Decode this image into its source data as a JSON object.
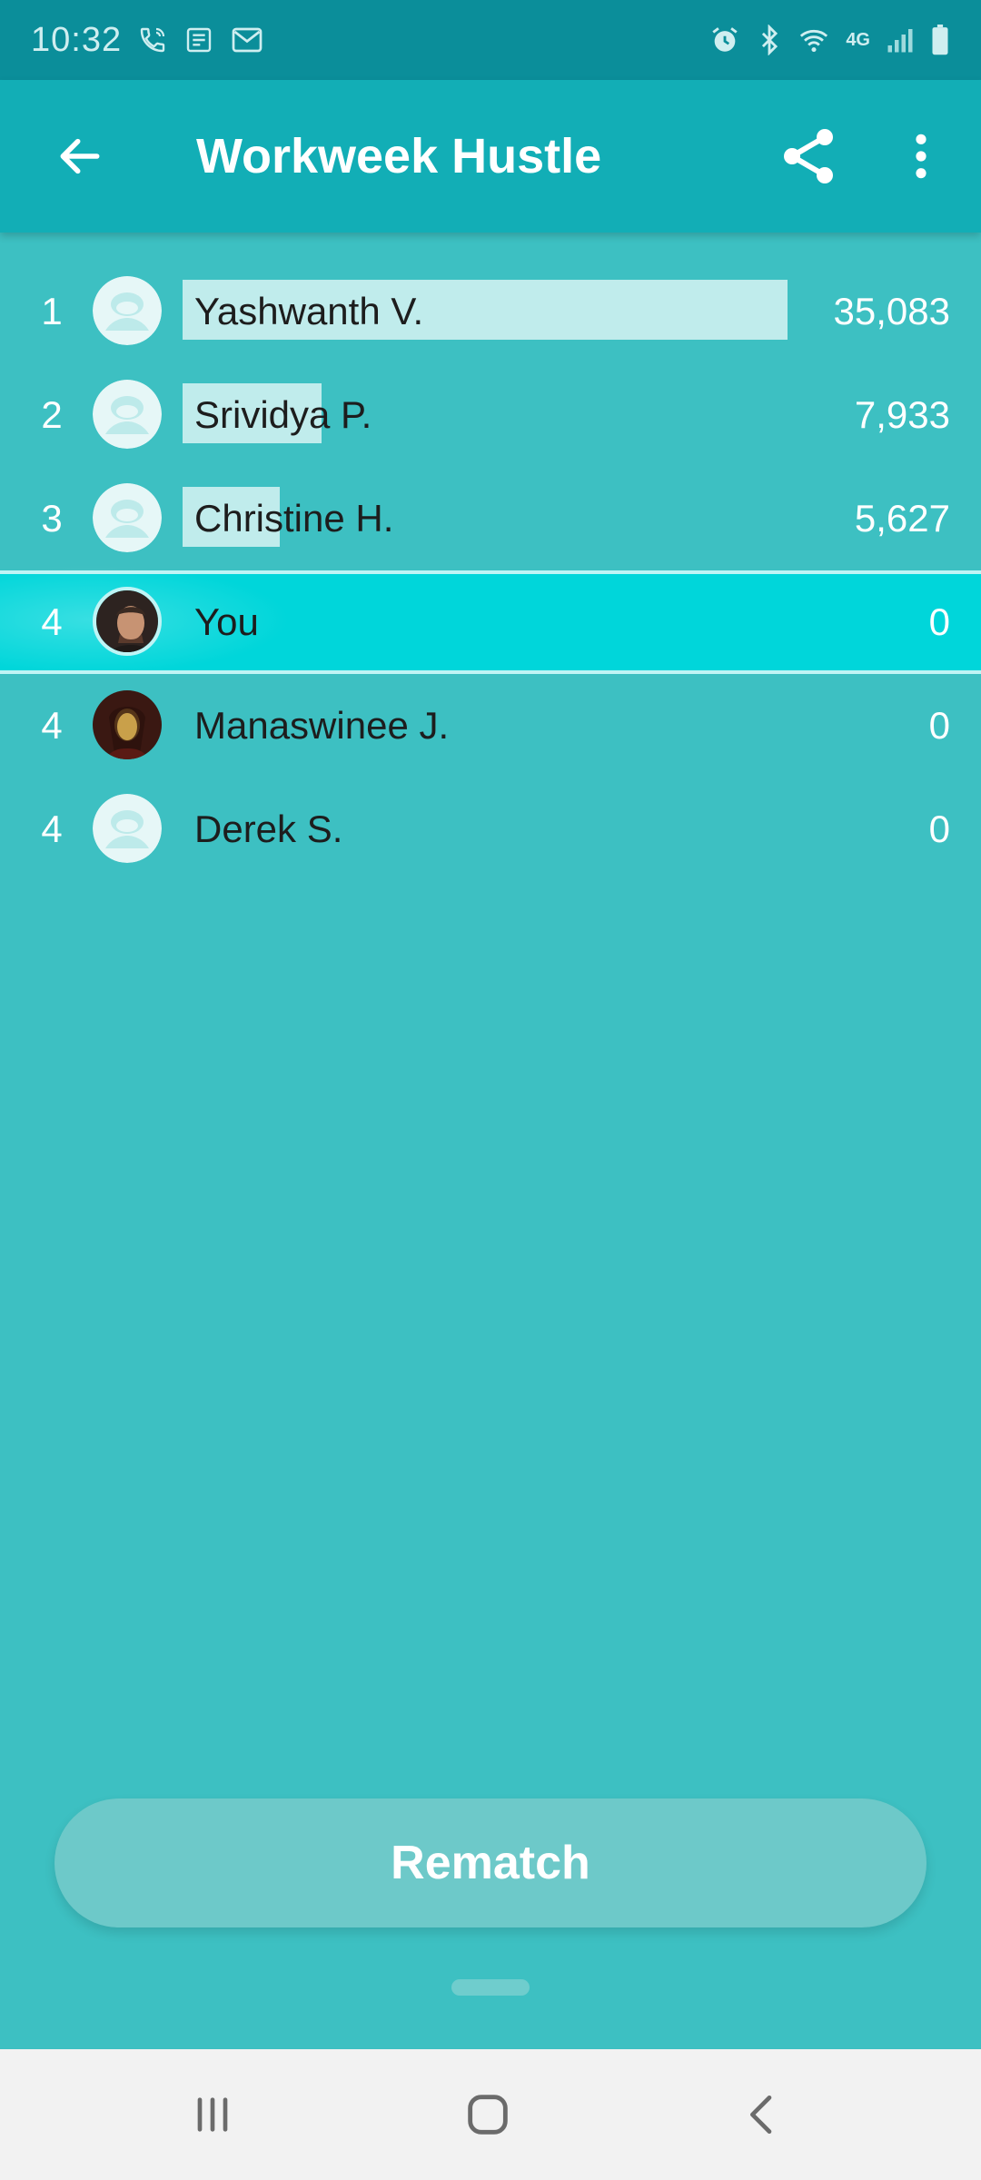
{
  "status_bar": {
    "time": "10:32",
    "left_icons": [
      "wifi-calling-icon",
      "news-icon",
      "mail-icon"
    ],
    "right_icons": [
      "alarm-icon",
      "bluetooth-icon",
      "wifi-icon",
      "lte-icon",
      "signal-icon",
      "battery-icon"
    ],
    "network_label": "4G"
  },
  "app_bar": {
    "title": "Workweek Hustle",
    "back_icon": "arrow-left-icon",
    "share_icon": "share-icon",
    "more_icon": "more-vertical-icon"
  },
  "leaderboard": [
    {
      "rank": "1",
      "name": "Yashwanth V.",
      "score": "35,083",
      "bar_fraction": 1.0,
      "avatar": "default-avatar-icon",
      "current": false
    },
    {
      "rank": "2",
      "name": "Srividya P.",
      "score": "7,933",
      "bar_fraction": 0.23,
      "avatar": "default-avatar-icon",
      "current": false
    },
    {
      "rank": "3",
      "name": "Christine H.",
      "score": "5,627",
      "bar_fraction": 0.16,
      "avatar": "default-avatar-icon",
      "current": false
    },
    {
      "rank": "4",
      "name": "You",
      "score": "0",
      "bar_fraction": 0,
      "avatar": "photo-avatar",
      "current": true
    },
    {
      "rank": "4",
      "name": "Manaswinee J.",
      "score": "0",
      "bar_fraction": 0,
      "avatar": "photo-avatar",
      "current": false
    },
    {
      "rank": "4",
      "name": "Derek S.",
      "score": "0",
      "bar_fraction": 0,
      "avatar": "default-avatar-icon",
      "current": false
    }
  ],
  "rematch_label": "Rematch",
  "nav_bar": {
    "recent_icon": "recent-apps-icon",
    "home_icon": "home-icon",
    "back_icon": "back-icon"
  },
  "colors": {
    "background": "#3dc0c2",
    "app_bar": "#12aeb6",
    "status_bar": "#0b8e9a",
    "current_row": "#00d6da",
    "progress_bar": "#c0ecec",
    "rematch": "#6dc9c9"
  }
}
